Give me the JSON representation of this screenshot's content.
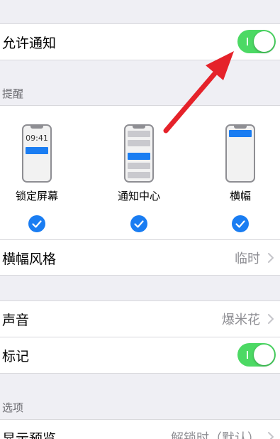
{
  "allow_notifications": {
    "label": "允许通知",
    "enabled": true
  },
  "alerts": {
    "header": "提醒",
    "styles": [
      {
        "label": "锁定屏幕",
        "checked": true,
        "preview_time": "09:41"
      },
      {
        "label": "通知中心",
        "checked": true
      },
      {
        "label": "横幅",
        "checked": true
      }
    ],
    "banner_style": {
      "label": "横幅风格",
      "value": "临时"
    }
  },
  "sounds": {
    "label": "声音",
    "value": "爆米花"
  },
  "badges": {
    "label": "标记",
    "enabled": true
  },
  "options": {
    "header": "选项",
    "show_previews": {
      "label": "显示预览",
      "value": "解锁时（默认）"
    }
  },
  "colors": {
    "toggle_on": "#4cd964",
    "accent": "#1a7df2",
    "arrow": "#e5222a"
  }
}
